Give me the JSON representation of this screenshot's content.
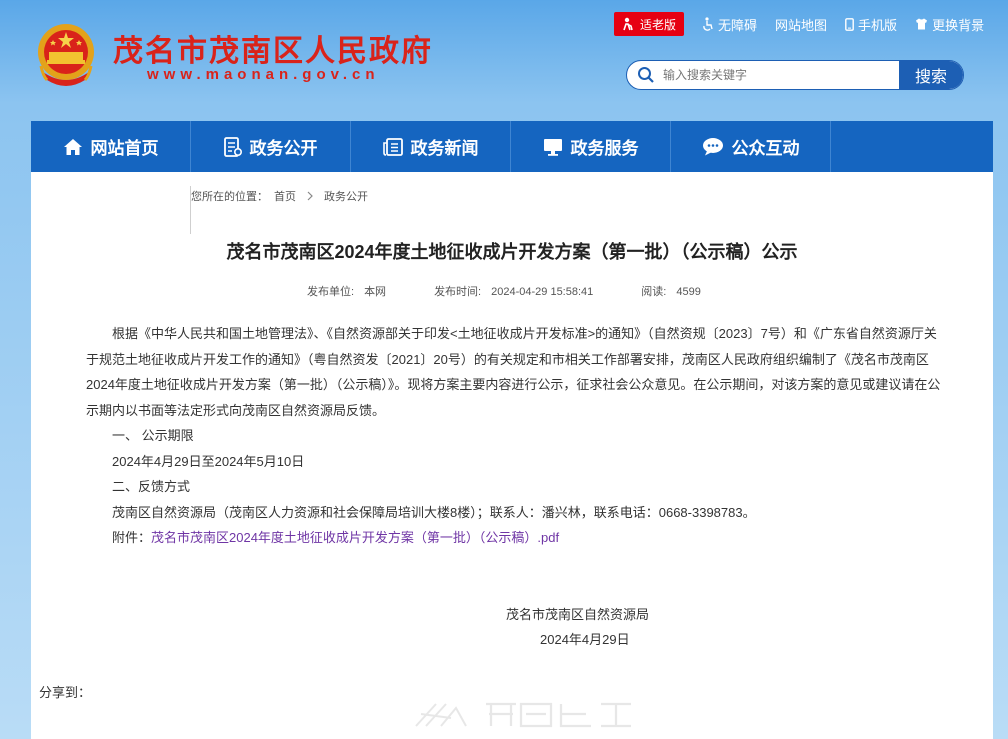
{
  "header": {
    "site_title": "茂名市茂南区人民政府",
    "site_url": "www.maonan.gov.cn"
  },
  "topbar": {
    "elder_mode": "适老版",
    "accessibility": "无障碍",
    "sitemap": "网站地图",
    "mobile": "手机版",
    "change_bg": "更换背景"
  },
  "search": {
    "placeholder": "输入搜索关键字",
    "button": "搜索"
  },
  "nav": {
    "items": [
      {
        "label": "网站首页",
        "icon": "home-icon"
      },
      {
        "label": "政务公开",
        "icon": "document-icon"
      },
      {
        "label": "政务新闻",
        "icon": "news-icon"
      },
      {
        "label": "政务服务",
        "icon": "monitor-icon"
      },
      {
        "label": "公众互动",
        "icon": "chat-icon"
      }
    ]
  },
  "breadcrumb": {
    "prefix": "您所在的位置：",
    "home": "首页",
    "current": "政务公开"
  },
  "article": {
    "title": "茂名市茂南区2024年度土地征收成片开发方案（第一批）（公示稿）公示",
    "meta": {
      "publisher_label": "发布单位:",
      "publisher": "本网",
      "time_label": "发布时间:",
      "time": "2024-04-29 15:58:41",
      "views_label": "阅读:",
      "views": "4599"
    },
    "paragraph": "根据《中华人民共和国土地管理法》、《自然资源部关于印发<土地征收成片开发标准>的通知》（自然资规〔2023〕7号）和《广东省自然资源厅关于规范土地征收成片开发工作的通知》（粤自然资发〔2021〕20号）的有关规定和市相关工作部署安排，茂南区人民政府组织编制了《茂名市茂南区2024年度土地征收成片开发方案（第一批）（公示稿）》。现将方案主要内容进行公示，征求社会公众意见。在公示期间，对该方案的意见或建议请在公示期内以书面等法定形式向茂南区自然资源局反馈。",
    "section1_title": "一、 公示期限",
    "section1_body": "2024年4月29日至2024年5月10日",
    "section2_title": "二、反馈方式",
    "section2_body": "茂南区自然资源局（茂南区人力资源和社会保障局培训大楼8楼）；联系人：潘兴林，联系电话：0668-3398783。",
    "attachment_label": "附件：",
    "attachment_link": "茂名市茂南区2024年度土地征收成片开发方案（第一批）（公示稿）.pdf",
    "signature_org": "茂名市茂南区自然资源局",
    "signature_date": "2024年4月29日"
  },
  "share": {
    "label": "分享到："
  },
  "colors": {
    "brand_red": "#d9231a",
    "nav_blue": "#1565c0",
    "link_purple": "#6f35a5"
  }
}
